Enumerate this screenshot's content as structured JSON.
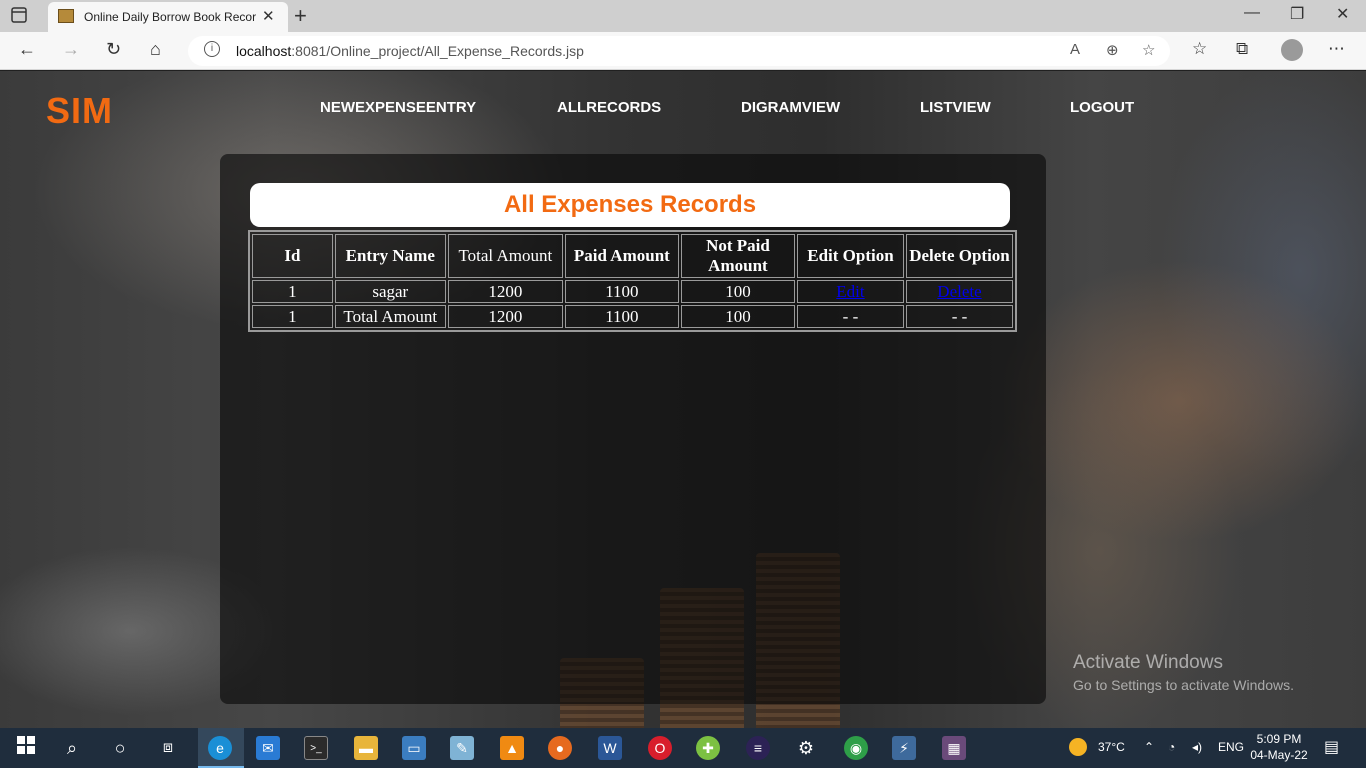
{
  "browser": {
    "tab_title": "Online Daily Borrow Book Recorc",
    "url_host": "localhost",
    "url_path": ":8081/Online_project/All_Expense_Records.jsp"
  },
  "app": {
    "logo": "SIM",
    "nav": [
      "NEWEXPENSEENTRY",
      "ALLRECORDS",
      "DIGRAMVIEW",
      "LISTVIEW",
      "LOGOUT"
    ]
  },
  "records": {
    "heading": "All Expenses Records",
    "columns": [
      "Id",
      "Entry Name",
      "Total Amount",
      "Paid Amount",
      "Not Paid Amount",
      "Edit Option",
      "Delete Option"
    ],
    "rows": [
      {
        "id": "1",
        "entry_name": "sagar",
        "total_amount": "1200",
        "paid_amount": "1100",
        "not_paid_amount": "100",
        "edit": "Edit",
        "delete": "Delete"
      },
      {
        "id": "1",
        "entry_name": "Total Amount",
        "total_amount": "1200",
        "paid_amount": "1100",
        "not_paid_amount": "100",
        "edit": "- -",
        "delete": "- -"
      }
    ]
  },
  "watermark": {
    "line1": "Activate Windows",
    "line2": "Go to Settings to activate Windows."
  },
  "taskbar": {
    "temperature": "37°C",
    "language": "ENG",
    "time": "5:09 PM",
    "date": "04-May-22"
  }
}
